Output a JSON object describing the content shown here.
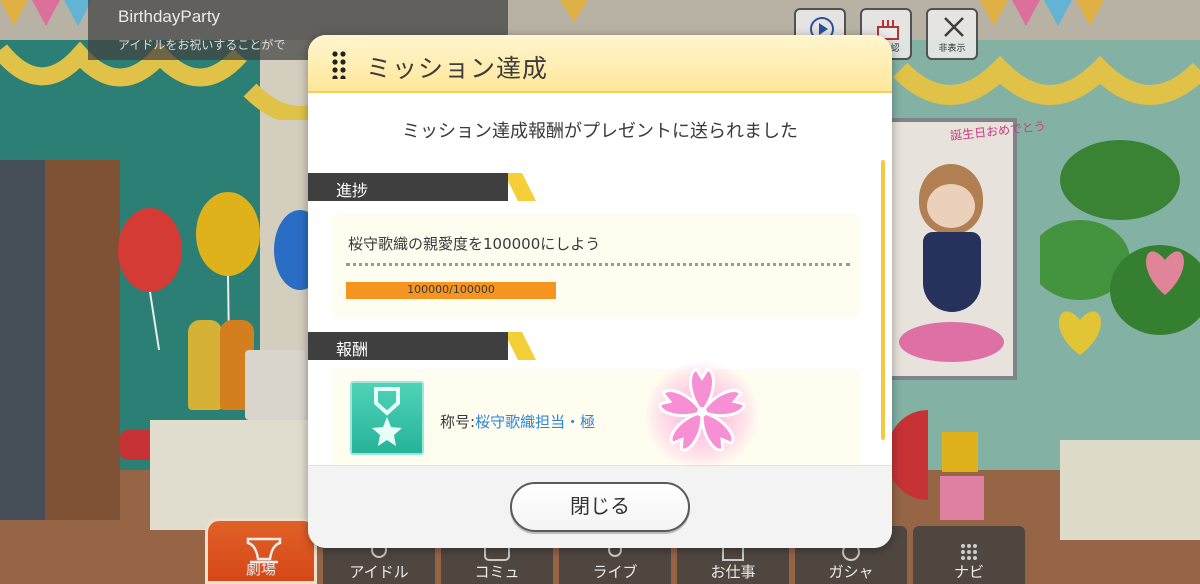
{
  "hud": {
    "event_title": "BirthdayParty",
    "event_subtitle": "アイドルをお祝いすることがで",
    "buttons": [
      {
        "label": "",
        "icon": "play-icon"
      },
      {
        "label": "日確認",
        "icon": "cake-icon"
      },
      {
        "label": "非表示",
        "icon": "close-icon"
      }
    ]
  },
  "scene": {
    "poster_text": "誕生日おめでとう"
  },
  "dialog": {
    "title": "ミッション達成",
    "message": "ミッション達成報酬がプレゼントに送られました",
    "progress_section": {
      "label": "進捗",
      "task": "桜守歌織の親愛度を100000にしよう",
      "progress_text": "100000/100000",
      "progress_fraction": 1.0
    },
    "reward_section": {
      "label": "報酬",
      "reward_prefix": "称号:",
      "reward_value": "桜守歌織担当・極",
      "reward_icon": "medal-icon"
    },
    "close_label": "閉じる"
  },
  "bottom_nav": [
    {
      "label": "劇場",
      "icon": "theater-icon",
      "active": true
    },
    {
      "label": "アイドル",
      "icon": "idol-icon",
      "active": false
    },
    {
      "label": "コミュ",
      "icon": "commu-icon",
      "active": false
    },
    {
      "label": "ライブ",
      "icon": "live-icon",
      "active": false
    },
    {
      "label": "お仕事",
      "icon": "work-icon",
      "active": false
    },
    {
      "label": "ガシャ",
      "icon": "gacha-icon",
      "active": false
    },
    {
      "label": "ナビ",
      "icon": "navi-icon",
      "active": false
    }
  ],
  "colors": {
    "accent_orange": "#f5951f",
    "link_blue": "#2f86d6",
    "header_yellow": "#ffe79a",
    "nav_active": "#ef5a22"
  }
}
